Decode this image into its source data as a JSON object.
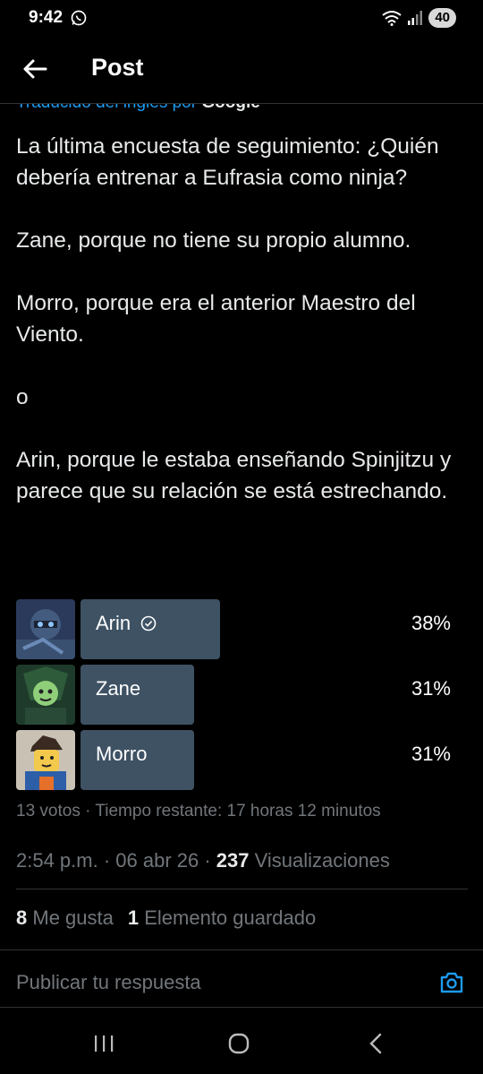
{
  "status_bar": {
    "time": "9:42",
    "battery": "40"
  },
  "header": {
    "title": "Post"
  },
  "translation": {
    "text": "Traducido del inglés por",
    "brand": "Google"
  },
  "post": {
    "lines": [
      "La última encuesta de seguimiento: ¿Quién debería entrenar a Eufrasia como ninja?",
      "",
      "Zane, porque no tiene su propio alumno.",
      "",
      "Morro, porque era el anterior Maestro del Viento.",
      "",
      "o",
      "",
      "Arin, porque le estaba enseñando Spinjitzu y parece que su relación se está estrechando."
    ]
  },
  "poll": {
    "options": [
      {
        "label": "Arin",
        "percent": "38%",
        "fraction": 0.38,
        "selected": true
      },
      {
        "label": "Zane",
        "percent": "31%",
        "fraction": 0.31,
        "selected": false
      },
      {
        "label": "Morro",
        "percent": "31%",
        "fraction": 0.31,
        "selected": false
      }
    ],
    "meta": "13 votos · Tiempo restante: 17 horas 12 minutos"
  },
  "timestamp": {
    "text": "2:54 p.m. · 06 abr 26 · ",
    "views_count": "237",
    "views_label": " Visualizaciones"
  },
  "stats": {
    "likes_count": "8",
    "likes_label": " Me gusta",
    "saves_count": "1",
    "saves_label": " Elemento guardado"
  },
  "reply": {
    "placeholder": "Publicar tu respuesta"
  },
  "colors": {
    "accent": "#1d9bf0",
    "poll_bar": "#3e5264",
    "muted": "#71767b",
    "background": "#000000"
  }
}
